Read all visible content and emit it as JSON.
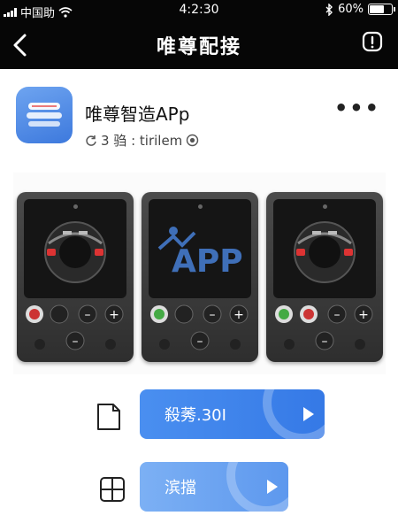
{
  "status_bar": {
    "carrier": "中国助",
    "time": "4:2:30",
    "battery_text": "60%",
    "battery_level": 0.6
  },
  "nav": {
    "title": "唯尊配接"
  },
  "app": {
    "name": "唯尊智造APp",
    "meta": "3 驺 : tirilem"
  },
  "product_image": {
    "center_screen_text": "APP"
  },
  "actions": [
    {
      "label": "殺莠.30I"
    },
    {
      "label": "滨擋"
    }
  ],
  "colors": {
    "primary": "#3b7fe8",
    "secondary": "#6aa3f1",
    "topbar": "#060606",
    "icon_blue": "#4a86e8"
  }
}
